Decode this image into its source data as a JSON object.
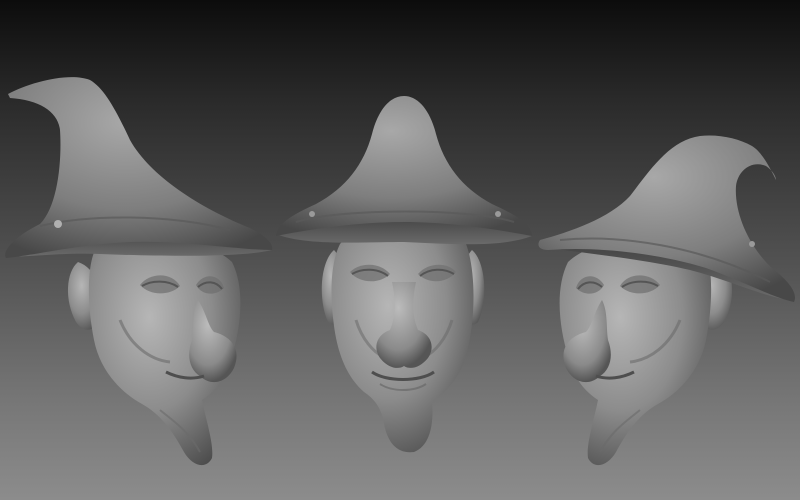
{
  "scene": {
    "subject": "three-views-witch-head-sculpt",
    "views": [
      {
        "id": "left",
        "angle": "three-quarter-left"
      },
      {
        "id": "front",
        "angle": "front"
      },
      {
        "id": "right",
        "angle": "three-quarter-right"
      }
    ],
    "colors": {
      "background_top": "#0c0c0c",
      "background_bottom": "#8c8c8c",
      "clay_light": "#b4b4b4",
      "clay_mid": "#8a8a8a",
      "clay_dark": "#4a4a4a"
    }
  }
}
